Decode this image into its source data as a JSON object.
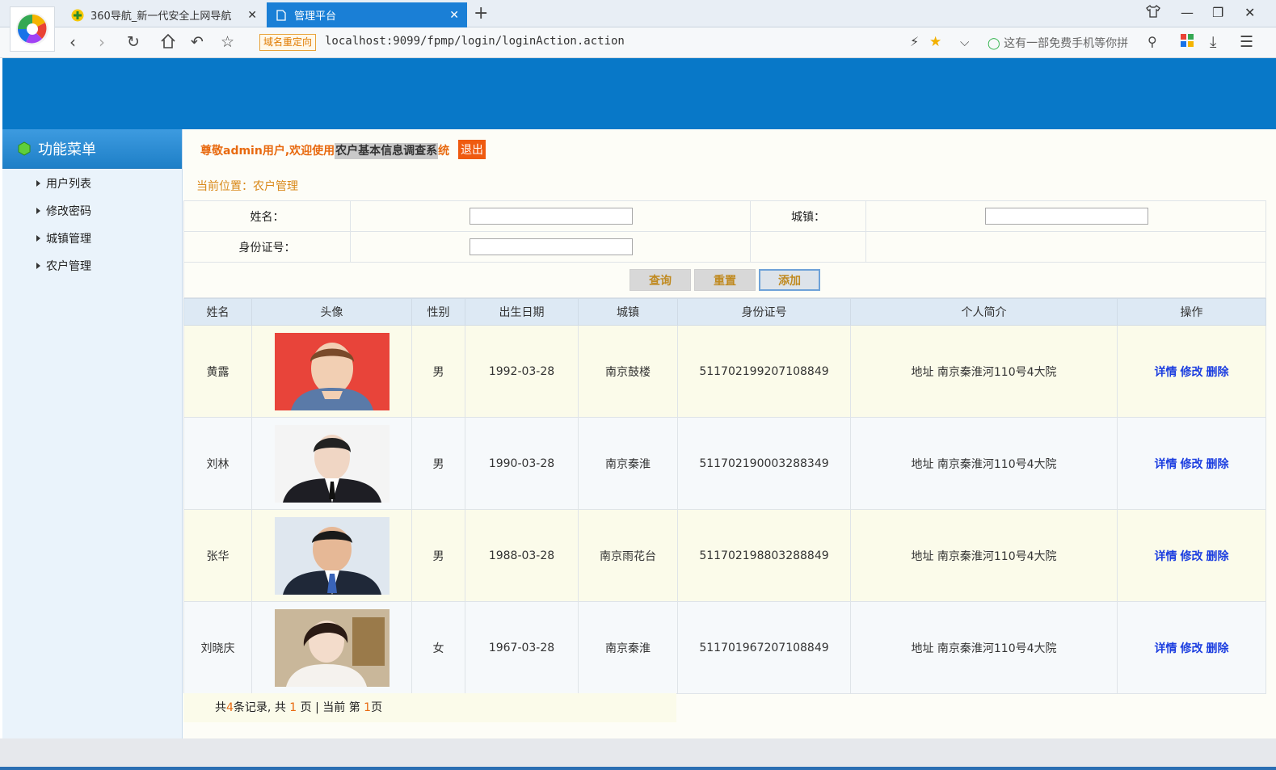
{
  "browser": {
    "tabs": [
      {
        "label": "360导航_新一代安全上网导航",
        "active": false
      },
      {
        "label": "管理平台",
        "active": true
      }
    ],
    "redirect_badge": "域名重定向",
    "url": "localhost:9099/fpmp/login/loginAction.action",
    "search_hint": "这有一部免费手机等你拼"
  },
  "sidebar": {
    "title": "功能菜单",
    "items": [
      {
        "label": "用户列表"
      },
      {
        "label": "修改密码"
      },
      {
        "label": "城镇管理"
      },
      {
        "label": "农户管理"
      }
    ]
  },
  "header": {
    "welcome_prefix": "尊敬admin用户,欢迎使用",
    "system_name_highlight": "农户基本信息调查系",
    "system_name_tail": "统",
    "logout": "退出",
    "breadcrumb": "当前位置：农户管理"
  },
  "search": {
    "name_label": "姓名：",
    "town_label": "城镇：",
    "id_label": "身份证号：",
    "name_value": "",
    "town_value": "",
    "id_value": "",
    "query_button": "查询",
    "reset_button": "重置",
    "add_button": "添加"
  },
  "table": {
    "headers": [
      "姓名",
      "头像",
      "性别",
      "出生日期",
      "城镇",
      "身份证号",
      "个人简介",
      "操作"
    ],
    "rows": [
      {
        "name": "黄露",
        "gender": "男",
        "birth": "1992-03-28",
        "town": "南京鼓楼",
        "id": "511702199207108849",
        "intro": "地址 南京秦淮河110号4大院"
      },
      {
        "name": "刘林",
        "gender": "男",
        "birth": "1990-03-28",
        "town": "南京秦淮",
        "id": "511702190003288349",
        "intro": "地址 南京秦淮河110号4大院"
      },
      {
        "name": "张华",
        "gender": "男",
        "birth": "1988-03-28",
        "town": "南京雨花台",
        "id": "511702198803288849",
        "intro": "地址 南京秦淮河110号4大院"
      },
      {
        "name": "刘晓庆",
        "gender": "女",
        "birth": "1967-03-28",
        "town": "南京秦淮",
        "id": "511701967207108849",
        "intro": "地址 南京秦淮河110号4大院"
      }
    ],
    "ops": {
      "detail": "详情",
      "edit": "修改",
      "delete": "删除"
    }
  },
  "pager": {
    "p1": "共",
    "total": "4",
    "p2": "条记录, 共 ",
    "pages": "1",
    "p3": " 页 | 当前 第 ",
    "current": "1",
    "p4": "页"
  }
}
